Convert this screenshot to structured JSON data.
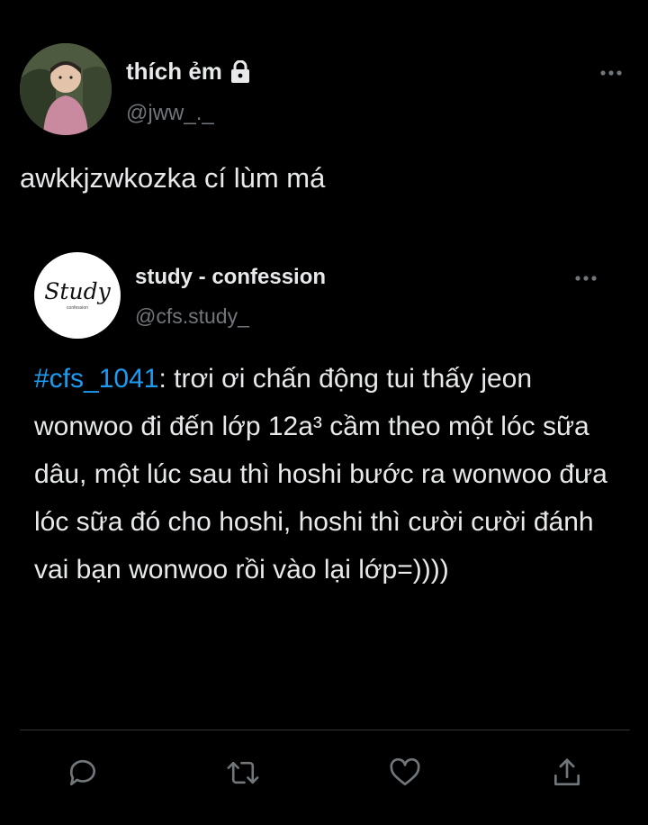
{
  "tweet": {
    "display_name": "thích ẻm",
    "handle": "@jww_._",
    "text": "awkkjzwkozka cí lùm má",
    "protected_icon": "lock-icon",
    "more_icon": "more-horizontal-icon"
  },
  "quoted_tweet": {
    "display_name": "study - confession",
    "handle": "@cfs.study_",
    "avatar_logo_text": "Study",
    "avatar_logo_subtext": "confession",
    "hashtag": "#cfs_1041",
    "body": ": trơi ơi chấn động tui thấy jeon wonwoo đi đến lớp 12a³ cầm theo một lóc sữa dâu, một lúc sau thì hoshi bước ra wonwoo đưa lóc sữa đó cho hoshi, hoshi thì cười cười đánh vai bạn wonwoo rồi vào lại lớp=))))",
    "more_icon": "more-horizontal-icon"
  },
  "actions": [
    {
      "name": "reply",
      "icon": "reply-icon"
    },
    {
      "name": "retweet",
      "icon": "retweet-icon"
    },
    {
      "name": "like",
      "icon": "heart-icon"
    },
    {
      "name": "share",
      "icon": "share-icon"
    }
  ],
  "colors": {
    "background": "#000000",
    "text": "#e7e9ea",
    "secondary": "#71767b",
    "accent": "#1d9bf0",
    "divider": "#2f3336"
  }
}
